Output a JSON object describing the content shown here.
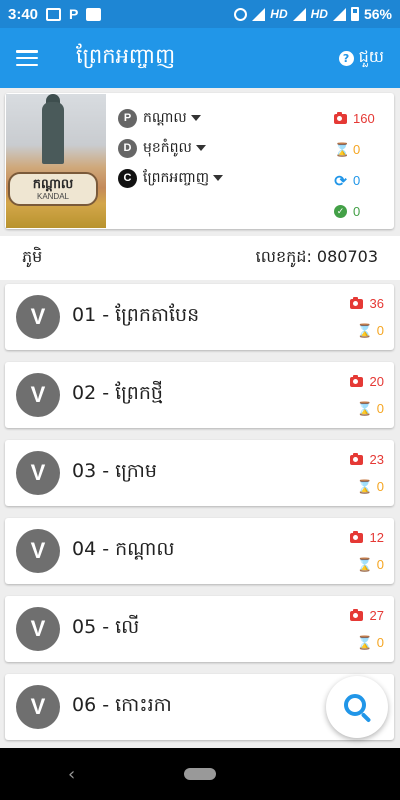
{
  "status_bar": {
    "time": "3:40",
    "hd1": "HD",
    "hd2": "HD",
    "battery": "56%"
  },
  "app_bar": {
    "title": "ព្រែកអញ្ចាញ",
    "help_label": "ជួយ",
    "help_icon_glyph": "?"
  },
  "header": {
    "photo_sign_kh": "កណ្ដាល",
    "photo_sign_en": "KANDAL",
    "levels": [
      {
        "badge": "P",
        "label": "កណ្ដាល"
      },
      {
        "badge": "D",
        "label": "មុខកំពូល"
      },
      {
        "badge": "C",
        "label": "ព្រែកអញ្ចាញ"
      }
    ],
    "stats": {
      "photos": "160",
      "pending": "0",
      "sync": "0",
      "done": "0"
    }
  },
  "section": {
    "label": "ភូមិ",
    "code": "លេខកូដ: 080703"
  },
  "villages": [
    {
      "badge": "V",
      "name": "01 - ព្រែកតាបែន",
      "photos": "36",
      "pending": "0"
    },
    {
      "badge": "V",
      "name": "02 - ព្រែកថ្មី",
      "photos": "20",
      "pending": "0"
    },
    {
      "badge": "V",
      "name": "03 - ក្រោម",
      "photos": "23",
      "pending": "0"
    },
    {
      "badge": "V",
      "name": "04 - កណ្ដាល",
      "photos": "12",
      "pending": "0"
    },
    {
      "badge": "V",
      "name": "05 - លើ",
      "photos": "27",
      "pending": "0"
    },
    {
      "badge": "V",
      "name": "06 - កោះរកា"
    }
  ],
  "glyphs": {
    "hourglass": "⌛",
    "sync": "⟳",
    "check": "✓",
    "back": "‹"
  },
  "colors": {
    "primary": "#2196e8",
    "status_bar": "#1e86d4",
    "camera": "#e53935",
    "pending": "#f5a623",
    "done": "#43a047"
  }
}
